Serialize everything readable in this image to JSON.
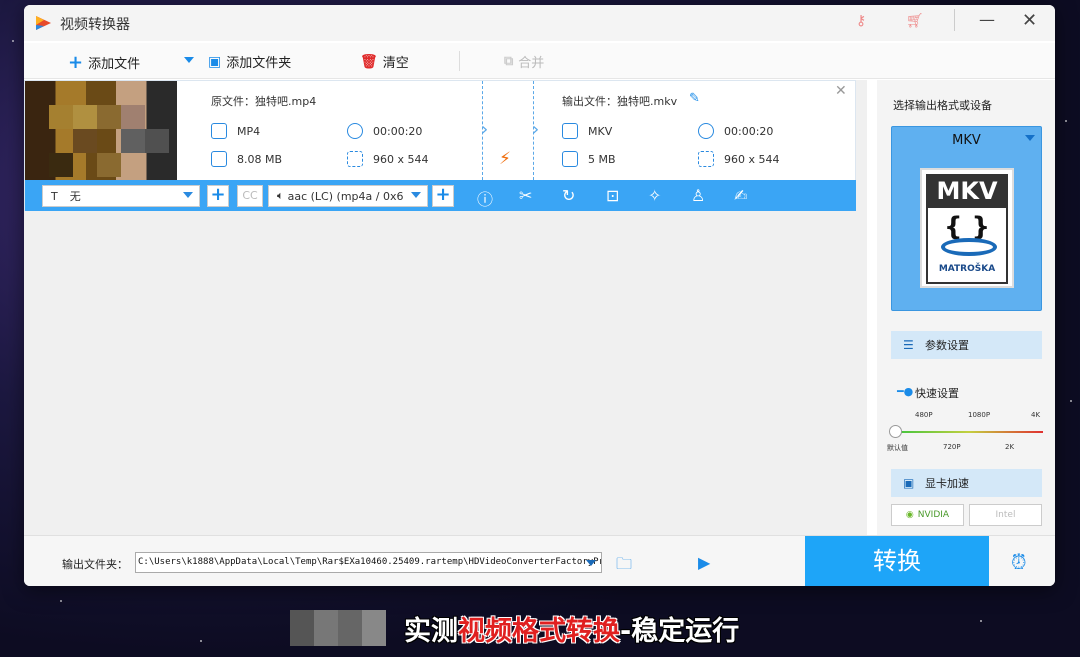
{
  "window": {
    "title": "视频转换器"
  },
  "toolbar": {
    "add_file": "添加文件",
    "add_folder": "添加文件夹",
    "clear": "清空",
    "merge": "合并"
  },
  "item": {
    "source_label": "原文件：",
    "source_name": "独特吧.mp4",
    "source_format": "MP4",
    "source_duration": "00:00:20",
    "source_size": "8.08 MB",
    "source_resolution": "960 x 544",
    "output_label": "输出文件：",
    "output_name": "独特吧.mkv",
    "output_format": "MKV",
    "output_duration": "00:00:20",
    "output_size": "5 MB",
    "output_resolution": "960 x 544"
  },
  "item_bar": {
    "subtitle_value": "无",
    "subtitle_prefix": "T",
    "cc_label": "CC",
    "audio_value": "aac (LC) (mp4a / 0x6"
  },
  "right_panel": {
    "title": "选择输出格式或设备",
    "format_name": "MKV",
    "mkv_logo": "MKV",
    "mkv_braces": "{ }",
    "mkv_brand": "MATROŠKA",
    "params_label": "参数设置",
    "speed_title": "快速设置",
    "ticks_top": [
      "480P",
      "1080P",
      "4K"
    ],
    "ticks_bottom": [
      "默认值",
      "720P",
      "2K"
    ],
    "gpu_label": "显卡加速",
    "gpu_nvidia": "NVIDIA",
    "gpu_intel": "Intel"
  },
  "footer": {
    "output_folder_label": "输出文件夹：",
    "output_path": "C:\\Users\\k1888\\AppData\\Local\\Temp\\Rar$EXa10460.25409.rartemp\\HDVideoConverterFactoryPro\\Out",
    "convert_label": "转换"
  },
  "caption": {
    "part1": "实测",
    "part2": "视频格式转换",
    "part3": "-稳定运行"
  }
}
